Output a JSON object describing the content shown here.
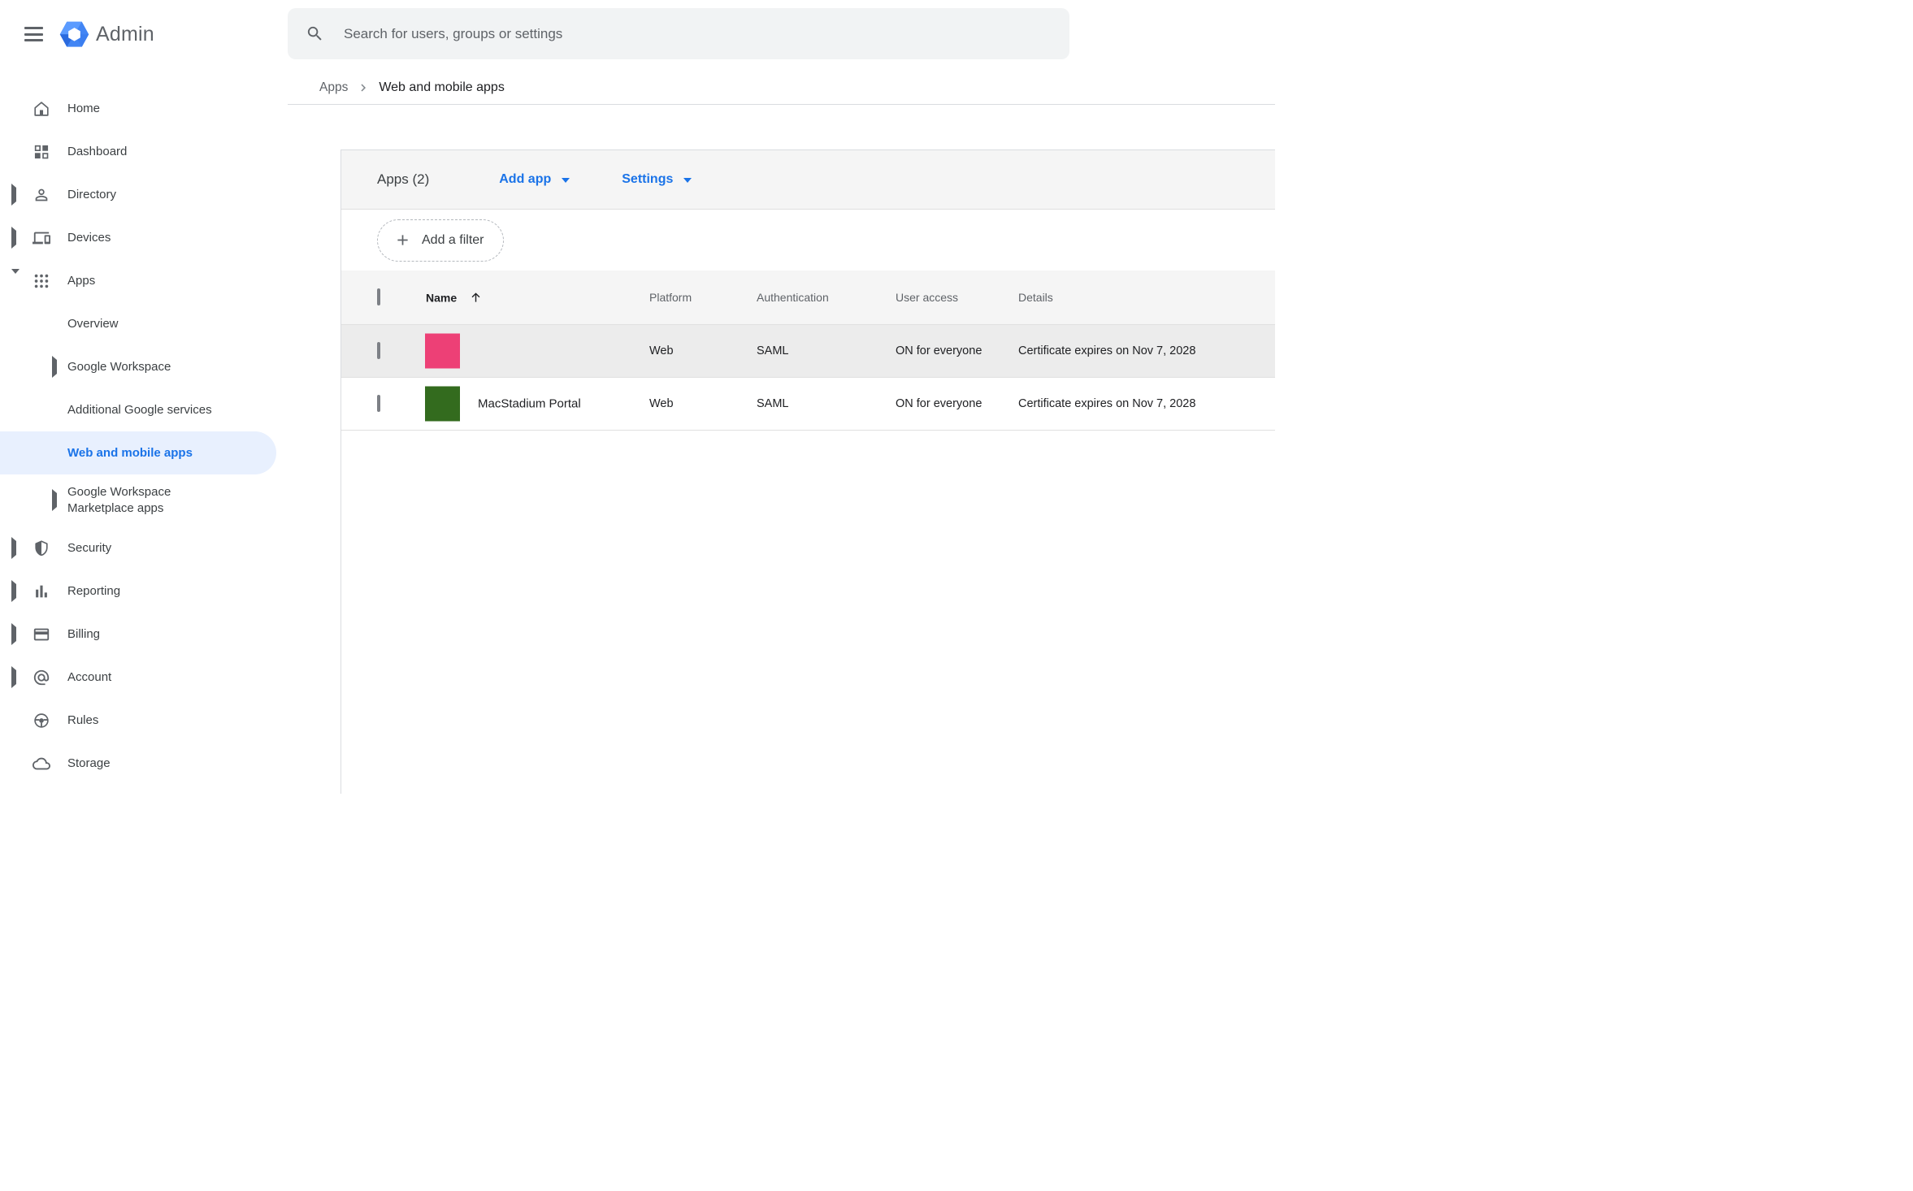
{
  "topbar": {
    "product_name": "Admin",
    "search_placeholder": "Search for users, groups or settings"
  },
  "breadcrumb": {
    "parent": "Apps",
    "current": "Web and mobile apps"
  },
  "sidebar": {
    "items": [
      {
        "label": "Home",
        "icon": "home-icon"
      },
      {
        "label": "Dashboard",
        "icon": "dashboard-icon"
      },
      {
        "label": "Directory",
        "icon": "person-icon",
        "expand": "right"
      },
      {
        "label": "Devices",
        "icon": "devices-icon",
        "expand": "right"
      },
      {
        "label": "Apps",
        "icon": "apps-grid-icon",
        "expand": "down"
      },
      {
        "label": "Overview",
        "sub": true
      },
      {
        "label": "Google Workspace",
        "sub": true,
        "expand": "right"
      },
      {
        "label": "Additional Google services",
        "sub": true
      },
      {
        "label": "Web and mobile apps",
        "sub": true,
        "selected": true
      },
      {
        "label": "Google Workspace\nMarketplace apps",
        "sub": true,
        "expand": "right"
      },
      {
        "label": "Security",
        "icon": "shield-icon",
        "expand": "right"
      },
      {
        "label": "Reporting",
        "icon": "bar-chart-icon",
        "expand": "right"
      },
      {
        "label": "Billing",
        "icon": "credit-card-icon",
        "expand": "right"
      },
      {
        "label": "Account",
        "icon": "at-sign-icon",
        "expand": "right"
      },
      {
        "label": "Rules",
        "icon": "steering-wheel-icon"
      },
      {
        "label": "Storage",
        "icon": "cloud-icon"
      }
    ]
  },
  "main": {
    "toolbar": {
      "apps_count_label": "Apps (2)",
      "add_app_label": "Add app",
      "settings_label": "Settings"
    },
    "filter_chip_label": "Add a filter",
    "table": {
      "columns": {
        "name": "Name",
        "platform": "Platform",
        "authentication": "Authentication",
        "user_access": "User access",
        "details": "Details"
      },
      "rows": [
        {
          "name": "",
          "tile_color": "#ED4076",
          "platform": "Web",
          "authentication": "SAML",
          "user_access": "ON for everyone",
          "details": "Certificate expires on Nov 7, 2028"
        },
        {
          "name": "MacStadium Portal",
          "tile_color": "#336B1E",
          "platform": "Web",
          "authentication": "SAML",
          "user_access": "ON for everyone",
          "details": "Certificate expires on Nov 7, 2028"
        }
      ]
    }
  },
  "colors": {
    "accent_blue": "#1a73e8",
    "selected_pill_bg": "#e8f0fe",
    "row_highlight": "#ececec",
    "pink_tile": "#ED4076",
    "green_tile": "#336B1E"
  }
}
